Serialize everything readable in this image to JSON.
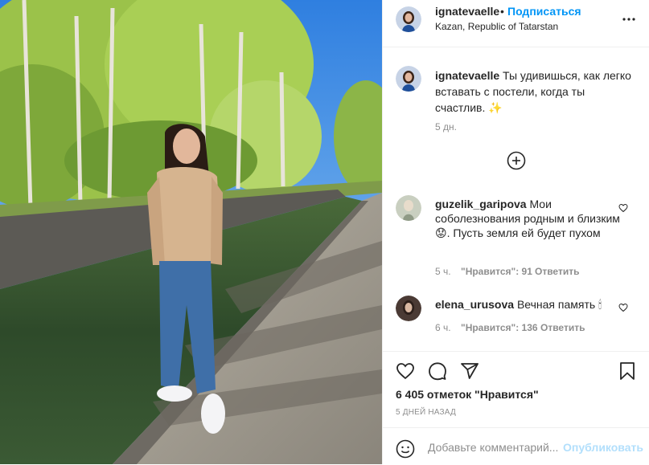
{
  "post": {
    "author": "ignatevaelle",
    "separator": "•",
    "follow_label": "Подписаться",
    "location": "Kazan, Republic of Tatarstan",
    "caption": "Ты удивишься, как легко вставать с постели, когда ты счастлив.",
    "caption_emoji": "✨",
    "caption_time": "5 дн.",
    "likes": "6 405 отметок \"Нравится\"",
    "date": "5 ДНЕЙ НАЗАД"
  },
  "comments": [
    {
      "user": "guzelik_garipova",
      "text": "Мои соболезнования родным и близким",
      "emoji": "😟",
      "text_after": ". Пусть земля ей будет пухом",
      "time": "5 ч.",
      "likes": "\"Нравится\": 91",
      "reply": "Ответить"
    },
    {
      "user": "elena_urusova",
      "text": "Вечная память",
      "emoji": "🕯",
      "time": "6 ч.",
      "likes": "\"Нравится\": 136",
      "reply": "Ответить"
    }
  ],
  "add_comment": {
    "placeholder": "Добавьте комментарий...",
    "publish_label": "Опубликовать"
  },
  "icons": {
    "more": "more-options-icon",
    "load_more": "plus-circle-icon",
    "like": "heart-icon",
    "comment": "comment-icon",
    "share": "send-icon",
    "save": "bookmark-icon",
    "emoji": "emoji-icon"
  },
  "colors": {
    "link_blue": "#0095f6",
    "publish_disabled": "#b2dffc",
    "secondary_text": "#8e8e8e"
  }
}
